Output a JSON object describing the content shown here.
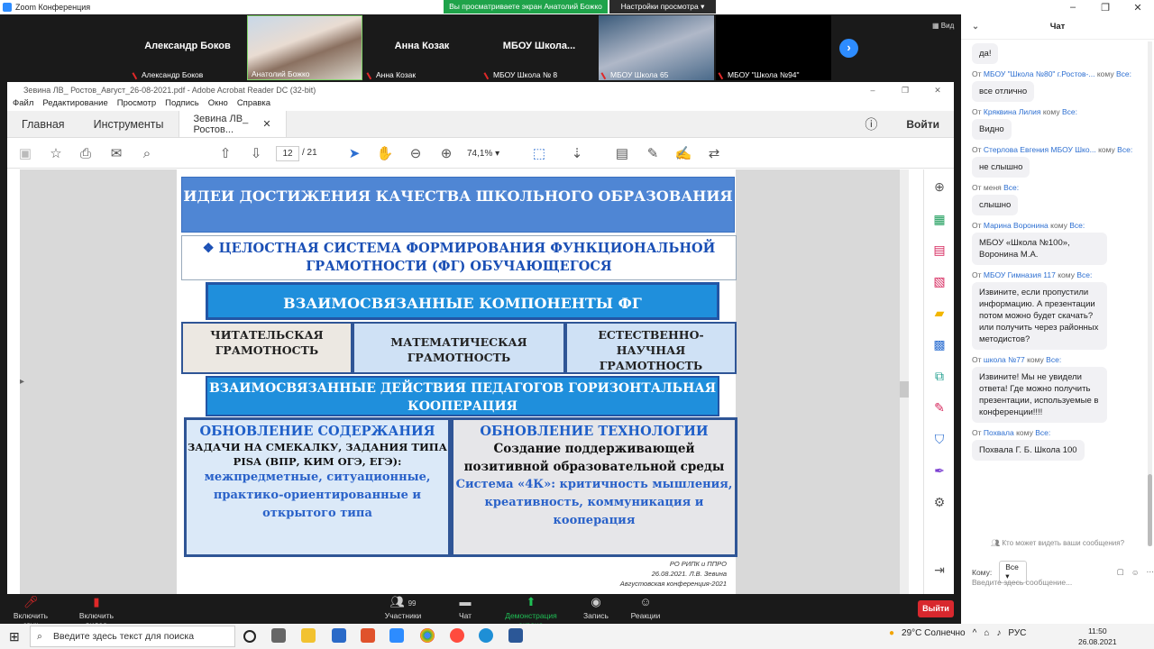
{
  "zoom": {
    "window_title": "Zoom Конференция",
    "share_banner": "Вы просматриваете экран Анатолий Божко",
    "view_options": "Настройки просмотра",
    "view_label": "Вид",
    "participants": [
      {
        "display": "Александр Боков",
        "label": "Александр Боков",
        "video": false
      },
      {
        "display": "",
        "label": "Анатолий Божко",
        "video": true
      },
      {
        "display": "Анна Козак",
        "label": "Анна Козак",
        "video": false
      },
      {
        "display": "МБОУ  Школа...",
        "label": "МБОУ Школа № 8",
        "video": false
      },
      {
        "display": "",
        "label": "МБОУ Школа 65",
        "video": true
      },
      {
        "display": "",
        "label": "МБОУ \"Школа №94\"",
        "video": false
      }
    ],
    "toolbar": {
      "mute": "Включить звук",
      "video": "Включить видео",
      "participants": "Участники",
      "participants_count": "99",
      "chat": "Чат",
      "share": "Демонстрация экрана",
      "record": "Запись",
      "reactions": "Реакции",
      "leave": "Выйти"
    }
  },
  "acrobat": {
    "title": "Зевина ЛВ_ Ростов_Август_26-08-2021.pdf - Adobe Acrobat Reader DC (32-bit)",
    "menu": [
      "Файл",
      "Редактирование",
      "Просмотр",
      "Подпись",
      "Окно",
      "Справка"
    ],
    "tabs": {
      "home": "Главная",
      "tools": "Инструменты",
      "doc": "Зевина ЛВ_ Ростов..."
    },
    "signin": "Войти",
    "page_current": "12",
    "page_total": "/ 21",
    "zoom": "74,1%"
  },
  "slide": {
    "title": "ИДЕИ ДОСТИЖЕНИЯ КАЧЕСТВА ШКОЛЬНОГО ОБРАЗОВАНИЯ",
    "subtitle": "❖ ЦЕЛОСТНАЯ СИСТЕМА ФОРМИРОВАНИЯ ФУНКЦИОНАЛЬНОЙ ГРАМОТНОСТИ (ФГ) ОБУЧАЮЩЕГОСЯ",
    "components": "ВЗАИМОСВЯЗАННЫЕ КОМПОНЕНТЫ ФГ",
    "literacy": [
      "ЧИТАТЕЛЬСКАЯ ГРАМОТНОСТЬ",
      "МАТЕМАТИЧЕСКАЯ ГРАМОТНОСТЬ",
      "ЕСТЕСТВЕННО-НАУЧНАЯ ГРАМОТНОСТЬ"
    ],
    "actions": "ВЗАИМОСВЯЗАННЫЕ ДЕЙСТВИЯ ПЕДАГОГОВ ГОРИЗОНТАЛЬНАЯ КООПЕРАЦИЯ",
    "left_head": "ОБНОВЛЕНИЕ СОДЕРЖАНИЯ",
    "left_text": "ЗАДАЧИ НА СМЕКАЛКУ, ЗАДАНИЯ ТИПА PISA (ВПР,  КИМ ОГЭ, ЕГЭ):",
    "left_blue": "межпредметные, ситуационные, практико-ориентированные и открытого типа",
    "right_head": "ОБНОВЛЕНИЕ ТЕХНОЛОГИИ",
    "right_text": "Создание поддерживающей позитивной  образовательной среды",
    "right_blue": "Система «4К»: критичность мышления, креативность, коммуникация и кооперация",
    "credit": [
      "РО РИПК и ППРО",
      "26.08.2021. Л.В. Зевина",
      "Августовская  конференция-2021"
    ]
  },
  "chat": {
    "title": "Чат",
    "messages": [
      {
        "from": "",
        "to": "",
        "text": "да!"
      },
      {
        "from": "МБОУ \"Школа №80\" г.Ростов-...",
        "to": "Все:",
        "text": "все отлично"
      },
      {
        "from": "Кряквина Лилия",
        "to": "Все:",
        "text": "Видно"
      },
      {
        "from": "Стерлова Евгения МБОУ Шко...",
        "to": "Все:",
        "text": "не слышно"
      },
      {
        "from": "меня",
        "to": "Все:",
        "text": "слышно"
      },
      {
        "from": "Марина Воронина",
        "to": "Все:",
        "text": "МБОУ «Школа №100», Воронина М.А."
      },
      {
        "from": "МБОУ Гимназия 117",
        "to": "Все:",
        "text": "Извините, если пропустили информацию. А презентации потом можно будет скачать? или получить через районных методистов?"
      },
      {
        "from": "школа №77",
        "to": "Все:",
        "text": "Извините! Мы не увидели ответа! Где можно получить презентации, используемые в конференции!!!!"
      },
      {
        "from": "Похвала",
        "to": "Все:",
        "text": "Похвала Г. Б. Школа 100"
      }
    ],
    "from_prefix": "От",
    "to_word": "кому",
    "who_can_see": "Кто может видеть ваши сообщения?",
    "to_label": "Кому:",
    "to_value": "Все",
    "input_placeholder": "Введите здесь сообщение..."
  },
  "taskbar": {
    "search": "Введите здесь текст для поиска",
    "weather": "29°C  Солнечно",
    "lang": "РУС",
    "time": "11:50",
    "date": "26.08.2021"
  }
}
